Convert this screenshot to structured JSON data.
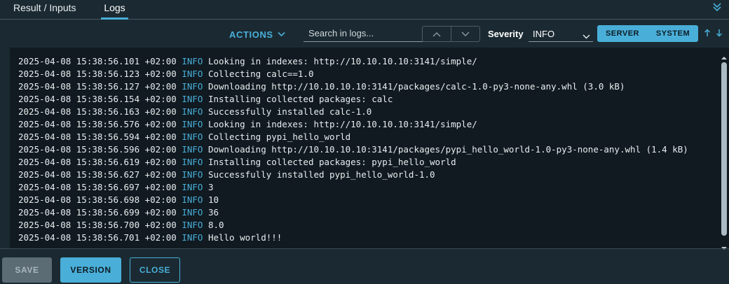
{
  "tabs": [
    {
      "label": "Result / Inputs",
      "active": false
    },
    {
      "label": "Logs",
      "active": true
    }
  ],
  "toolbar": {
    "actions_label": "ACTIONS",
    "search_placeholder": "Search in logs...",
    "search_value": "",
    "severity_label": "Severity",
    "severity_value": "INFO",
    "segments": [
      "SERVER",
      "SYSTEM"
    ]
  },
  "logs": [
    {
      "ts": "2025-04-08 15:38:56.101 +02:00",
      "level": "INFO",
      "msg": "Looking in indexes: http://10.10.10.10:3141/simple/"
    },
    {
      "ts": "2025-04-08 15:38:56.123 +02:00",
      "level": "INFO",
      "msg": "Collecting calc==1.0"
    },
    {
      "ts": "2025-04-08 15:38:56.127 +02:00",
      "level": "INFO",
      "msg": "Downloading http://10.10.10.10:3141/packages/calc-1.0-py3-none-any.whl (3.0 kB)"
    },
    {
      "ts": "2025-04-08 15:38:56.154 +02:00",
      "level": "INFO",
      "msg": "Installing collected packages: calc"
    },
    {
      "ts": "2025-04-08 15:38:56.163 +02:00",
      "level": "INFO",
      "msg": "Successfully installed calc-1.0"
    },
    {
      "ts": "2025-04-08 15:38:56.576 +02:00",
      "level": "INFO",
      "msg": "Looking in indexes: http://10.10.10.10:3141/simple/"
    },
    {
      "ts": "2025-04-08 15:38:56.594 +02:00",
      "level": "INFO",
      "msg": "Collecting pypi_hello_world"
    },
    {
      "ts": "2025-04-08 15:38:56.596 +02:00",
      "level": "INFO",
      "msg": "Downloading http://10.10.10.10:3141/packages/pypi_hello_world-1.0-py3-none-any.whl (1.4 kB)"
    },
    {
      "ts": "2025-04-08 15:38:56.619 +02:00",
      "level": "INFO",
      "msg": "Installing collected packages: pypi_hello_world"
    },
    {
      "ts": "2025-04-08 15:38:56.627 +02:00",
      "level": "INFO",
      "msg": "Successfully installed pypi_hello_world-1.0"
    },
    {
      "ts": "2025-04-08 15:38:56.697 +02:00",
      "level": "INFO",
      "msg": "3"
    },
    {
      "ts": "2025-04-08 15:38:56.698 +02:00",
      "level": "INFO",
      "msg": "10"
    },
    {
      "ts": "2025-04-08 15:38:56.699 +02:00",
      "level": "INFO",
      "msg": "36"
    },
    {
      "ts": "2025-04-08 15:38:56.700 +02:00",
      "level": "INFO",
      "msg": "8.0"
    },
    {
      "ts": "2025-04-08 15:38:56.701 +02:00",
      "level": "INFO",
      "msg": "Hello world!!!"
    }
  ],
  "footer": {
    "save_label": "SAVE",
    "version_label": "VERSION",
    "close_label": "CLOSE"
  },
  "icons": {
    "collapse": "double-chevron-down-icon",
    "actions_chevron": "chevron-down-icon",
    "prev_match": "chevron-up-icon",
    "next_match": "chevron-down-icon",
    "sort_asc": "arrow-up-icon",
    "sort_desc": "arrow-down-icon"
  },
  "colors": {
    "accent": "#49afd9",
    "background": "#1b2a32",
    "log_background": "#101a20",
    "disabled_button": "#5b6c74"
  }
}
